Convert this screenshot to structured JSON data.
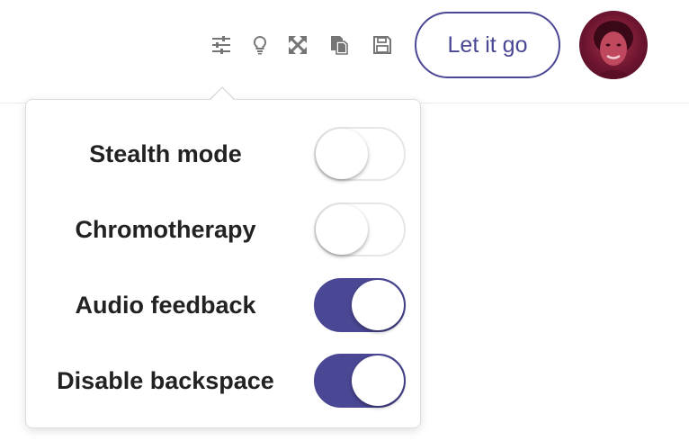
{
  "toolbar": {
    "icons": [
      "settings-sliders-icon",
      "lightbulb-icon",
      "fullscreen-icon",
      "clone-icon",
      "save-icon"
    ],
    "primary_button_label": "Let it go"
  },
  "settings": [
    {
      "label": "Stealth mode",
      "enabled": false
    },
    {
      "label": "Chromotherapy",
      "enabled": false
    },
    {
      "label": "Audio feedback",
      "enabled": true
    },
    {
      "label": "Disable backspace",
      "enabled": true
    }
  ],
  "colors": {
    "accent": "#4a4794",
    "icon": "#757575",
    "text": "#222222",
    "toggle_off_border": "#e6e6e6"
  }
}
